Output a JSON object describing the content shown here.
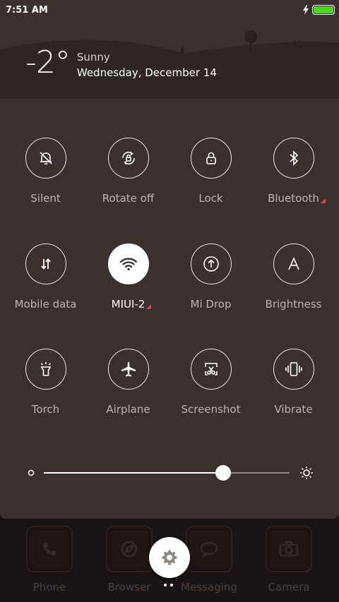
{
  "status_bar": {
    "time": "7:51 AM",
    "battery_level": 1.0,
    "battery_color": "#4cd624"
  },
  "weather": {
    "temperature": "-2°",
    "condition": "Sunny",
    "date": "Wednesday, December 14"
  },
  "toggles": [
    {
      "label": "Silent",
      "icon": "bell-off-icon",
      "active": false,
      "indicator": false
    },
    {
      "label": "Rotate off",
      "icon": "rotate-lock-icon",
      "active": false,
      "indicator": false
    },
    {
      "label": "Lock",
      "icon": "padlock-icon",
      "active": false,
      "indicator": false
    },
    {
      "label": "Bluetooth",
      "icon": "bluetooth-icon",
      "active": false,
      "indicator": true
    },
    {
      "label": "Mobile data",
      "icon": "mobile-data-icon",
      "active": false,
      "indicator": false
    },
    {
      "label": "MIUI-2",
      "icon": "wifi-icon",
      "active": true,
      "indicator": true
    },
    {
      "label": "Mi Drop",
      "icon": "mi-drop-icon",
      "active": false,
      "indicator": false
    },
    {
      "label": "Brightness",
      "icon": "auto-brightness-icon",
      "active": false,
      "indicator": false
    },
    {
      "label": "Torch",
      "icon": "torch-icon",
      "active": false,
      "indicator": false
    },
    {
      "label": "Airplane",
      "icon": "airplane-icon",
      "active": false,
      "indicator": false
    },
    {
      "label": "Screenshot",
      "icon": "screenshot-icon",
      "active": false,
      "indicator": false
    },
    {
      "label": "Vibrate",
      "icon": "vibrate-icon",
      "active": false,
      "indicator": false
    }
  ],
  "brightness": {
    "level": 0.73
  },
  "dock": [
    {
      "label": "Phone",
      "icon": "phone-icon"
    },
    {
      "label": "Browser",
      "icon": "browser-icon"
    },
    {
      "label": "Messaging",
      "icon": "messaging-icon"
    },
    {
      "label": "Camera",
      "icon": "camera-icon"
    }
  ],
  "colors": {
    "panel": "#3a302d",
    "indicator": "#f23c4b",
    "accent": "#ffffff"
  }
}
